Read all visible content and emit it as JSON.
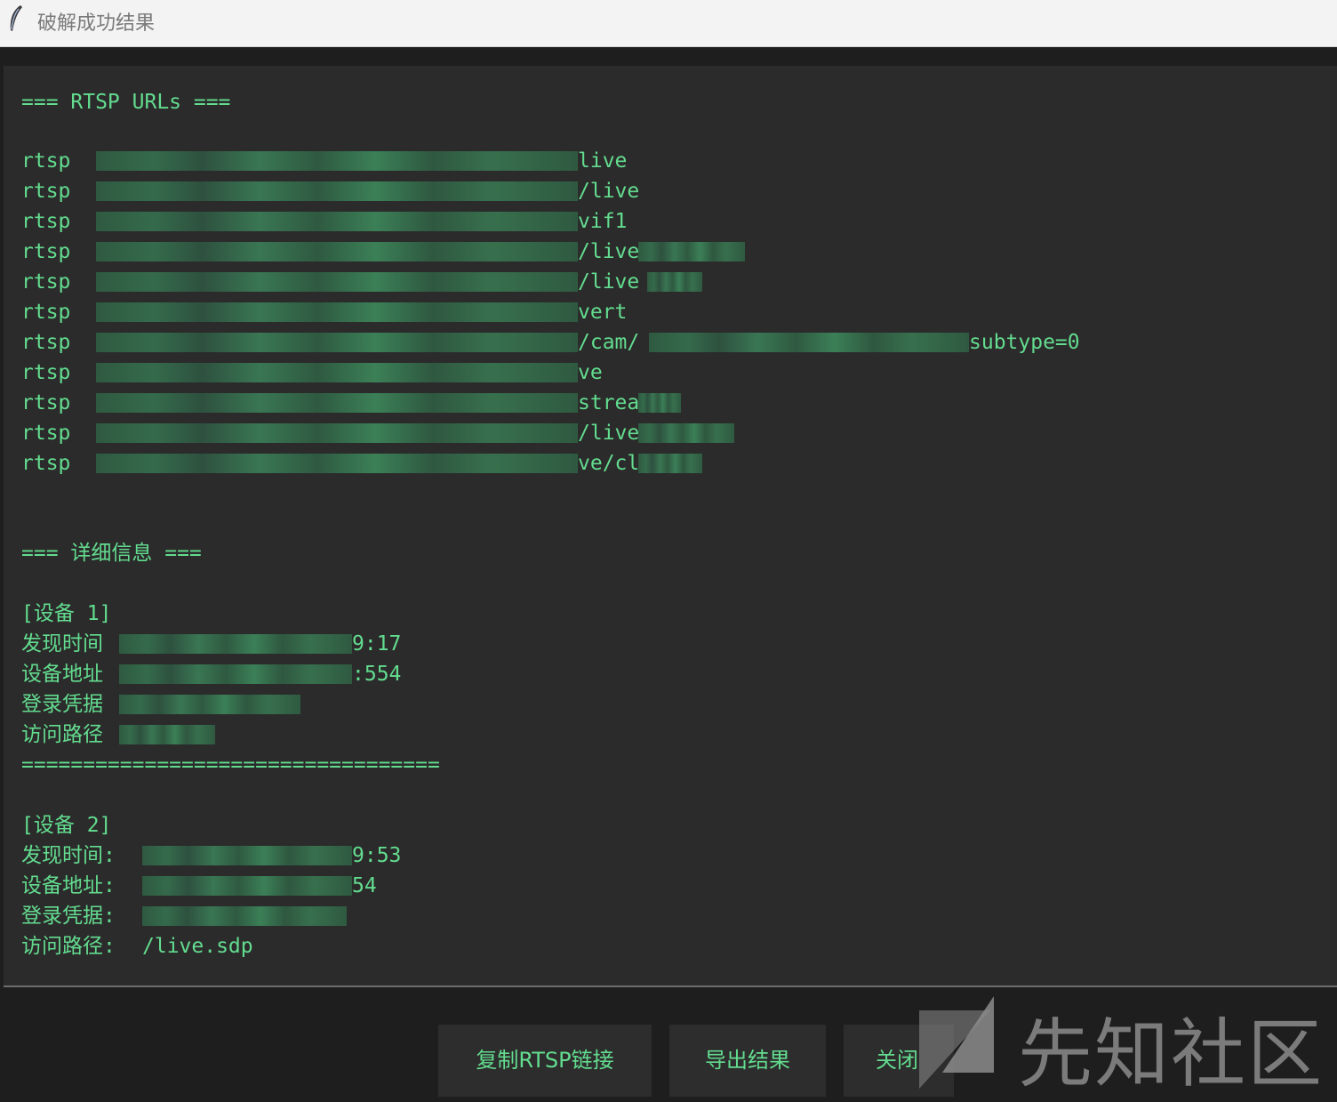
{
  "window": {
    "title": "破解成功结果",
    "icon": "feather-icon"
  },
  "output": {
    "header_urls": "=== RTSP URLs ===",
    "urls": [
      {
        "prefix": "rtsp",
        "suffix": "live"
      },
      {
        "prefix": "rtsp",
        "suffix": "/live"
      },
      {
        "prefix": "rtsp",
        "suffix": "vif1"
      },
      {
        "prefix": "rtsp",
        "suffix": "/live"
      },
      {
        "prefix": "rtsp",
        "suffix": "/live"
      },
      {
        "prefix": "rtsp",
        "suffix": "vert"
      },
      {
        "prefix": "rtsp",
        "suffix": "/cam/",
        "suffix2": "subtype=0"
      },
      {
        "prefix": "rtsp",
        "suffix": "ve"
      },
      {
        "prefix": "rtsp",
        "suffix": "strea"
      },
      {
        "prefix": "rtsp",
        "suffix": "/live"
      },
      {
        "prefix": "rtsp",
        "suffix": "ve/cl"
      }
    ],
    "header_details": "=== 详细信息 ===",
    "devices": [
      {
        "label": "[设备 1]",
        "found_time_label": "发现时间",
        "found_time_value": "9:17",
        "address_label": "设备地址",
        "address_value": ":554",
        "credentials_label": "登录凭据",
        "path_label": "访问路径",
        "separator": "=================================="
      },
      {
        "label": "[设备 2]",
        "found_time_label": "发现时间:",
        "found_time_value": "9:53",
        "address_label": "设备地址:",
        "address_value": "54",
        "credentials_label": "登录凭据:",
        "path_label": "访问路径:",
        "path_value": "/live.sdp"
      }
    ]
  },
  "buttons": {
    "copy": "复制RTSP链接",
    "export": "导出结果",
    "close": "关闭"
  },
  "watermark": "先知社区",
  "colors": {
    "text_green": "#63dc8f",
    "panel_bg": "#2b2b2b",
    "window_bg": "#1e1e1e",
    "titlebar_bg": "#f3f3f3"
  }
}
